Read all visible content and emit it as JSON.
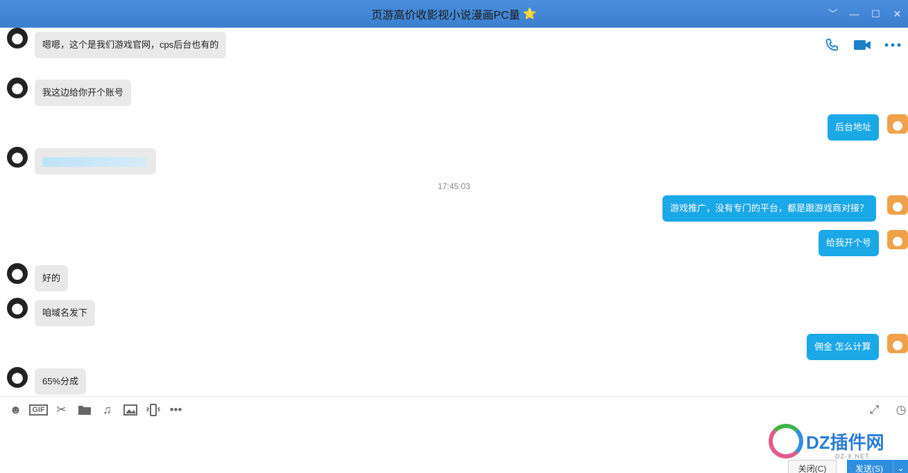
{
  "window": {
    "title": "页游高价收影视小说漫画PC量",
    "title_star": "⭐",
    "controls": [
      "﹀",
      "—",
      "☐",
      "✕"
    ]
  },
  "chat_actions": {
    "voice_call_icon": "phone-icon",
    "video_call_icon": "video-icon",
    "more_icon": "more-icon"
  },
  "messages": [
    {
      "from": "them",
      "text": "嗯嗯，这个是我们游戏官网，cps后台也有的"
    },
    {
      "from": "them",
      "text": "我这边给你开个账号"
    },
    {
      "from": "me",
      "text": "后台地址"
    },
    {
      "from": "them",
      "text": "..",
      "is_link": true
    },
    {
      "timestamp": "17:45:03"
    },
    {
      "from": "me",
      "text": "游戏推广，没有专门的平台，都是跟游戏商对接？"
    },
    {
      "from": "me",
      "text": "给我开个号"
    },
    {
      "from": "them",
      "text": "好的"
    },
    {
      "from": "them",
      "text": "咱域名发下"
    },
    {
      "from": "me",
      "text": "佣金 怎么计算"
    },
    {
      "from": "them",
      "text": "65%分成"
    }
  ],
  "toolbar": {
    "icons": [
      "emoji-icon",
      "gif-icon",
      "scissors-icon",
      "folder-icon",
      "music-icon",
      "image-icon",
      "shake-icon",
      "more-icon"
    ],
    "gif_label": "GIF",
    "right_icons": [
      "expand-icon",
      "history-icon"
    ]
  },
  "buttons": {
    "close_label": "关闭(C)",
    "send_label": "发送(S)"
  },
  "watermark": {
    "text": "DZ插件网",
    "sub": "DZ-X.NET"
  },
  "colors": {
    "titlebar": "#3b7fd0",
    "bubble_out": "#1ba8e6",
    "bubble_in": "#e9e9e9",
    "send_button": "#2f8ee0"
  }
}
